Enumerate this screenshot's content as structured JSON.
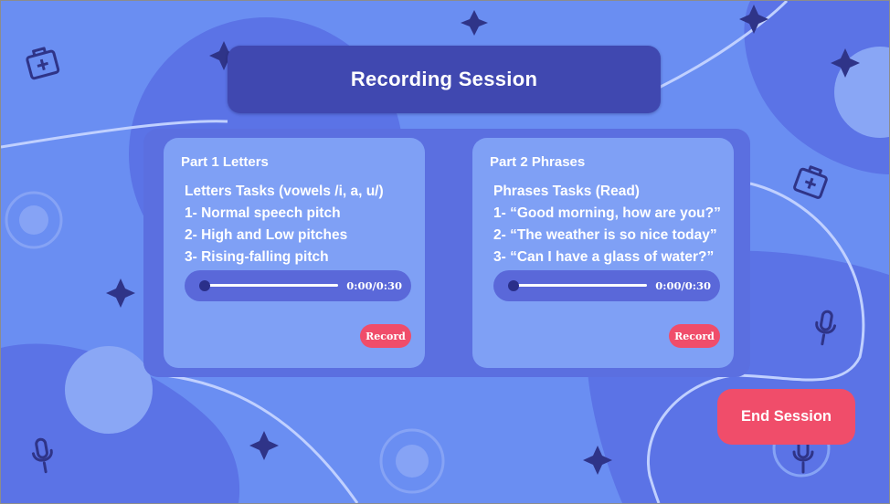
{
  "title": "Recording Session",
  "cards": [
    {
      "heading": "Part 1 Letters",
      "tasks": [
        "Letters Tasks (vowels /i, a, u/)",
        "1- Normal speech pitch",
        "2- High and Low pitches",
        "3- Rising-falling pitch"
      ],
      "player": {
        "time": "0:00/0:30",
        "progress": 0
      },
      "record_label": "Record"
    },
    {
      "heading": "Part 2 Phrases",
      "tasks": [
        "Phrases Tasks (Read)",
        "1- “Good morning, how are you?”",
        "2- “The weather is so nice today”",
        "3- “Can I have a glass of water?”"
      ],
      "player": {
        "time": "0:00/0:30",
        "progress": 0
      },
      "record_label": "Record"
    }
  ],
  "end_session_label": "End Session",
  "colors": {
    "background": "#6a8ef2",
    "title_bar": "#4048b0",
    "card": "#7fa0f5",
    "accent": "#f04d6a"
  },
  "icons": [
    "first-aid-kit-icon",
    "star-icon",
    "microphone-icon"
  ]
}
